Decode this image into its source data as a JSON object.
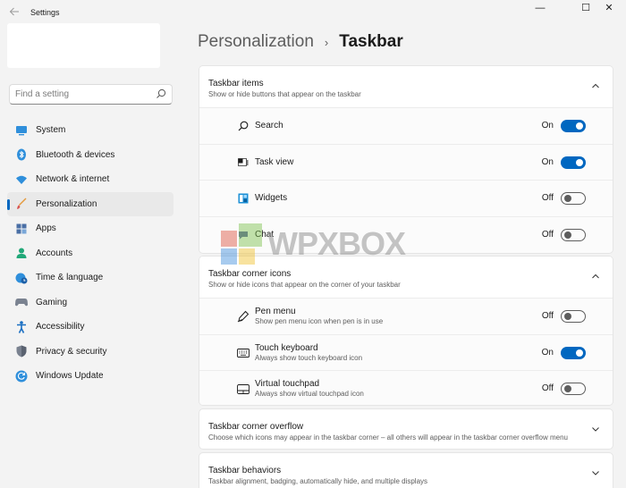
{
  "app": {
    "title": "Settings",
    "window_controls": {
      "minimize": "—",
      "maximize": "☐",
      "close": "✕"
    }
  },
  "search": {
    "placeholder": "Find a setting",
    "value": ""
  },
  "sidebar": {
    "items": [
      {
        "label": "System",
        "icon": "system-icon",
        "active": false
      },
      {
        "label": "Bluetooth & devices",
        "icon": "bluetooth-icon",
        "active": false
      },
      {
        "label": "Network & internet",
        "icon": "wifi-icon",
        "active": false
      },
      {
        "label": "Personalization",
        "icon": "brush-icon",
        "active": true
      },
      {
        "label": "Apps",
        "icon": "apps-icon",
        "active": false
      },
      {
        "label": "Accounts",
        "icon": "person-icon",
        "active": false
      },
      {
        "label": "Time & language",
        "icon": "globe-clock-icon",
        "active": false
      },
      {
        "label": "Gaming",
        "icon": "gamepad-icon",
        "active": false
      },
      {
        "label": "Accessibility",
        "icon": "accessibility-icon",
        "active": false
      },
      {
        "label": "Privacy & security",
        "icon": "shield-icon",
        "active": false
      },
      {
        "label": "Windows Update",
        "icon": "update-icon",
        "active": false
      }
    ]
  },
  "breadcrumb": {
    "parent": "Personalization",
    "separator": "›",
    "current": "Taskbar"
  },
  "taskbar_items": {
    "title": "Taskbar items",
    "description": "Show or hide buttons that appear on the taskbar",
    "rows": [
      {
        "label": "Search",
        "state": "On",
        "icon": "search-icon"
      },
      {
        "label": "Task view",
        "state": "On",
        "icon": "task-view-icon"
      },
      {
        "label": "Widgets",
        "state": "Off",
        "icon": "widgets-icon"
      },
      {
        "label": "Chat",
        "state": "Off",
        "icon": "chat-icon"
      }
    ]
  },
  "corner_icons": {
    "title": "Taskbar corner icons",
    "description": "Show or hide icons that appear on the corner of your taskbar",
    "rows": [
      {
        "label": "Pen menu",
        "sub": "Show pen menu icon when pen is in use",
        "state": "Off",
        "icon": "pen-icon"
      },
      {
        "label": "Touch keyboard",
        "sub": "Always show touch keyboard icon",
        "state": "On",
        "icon": "keyboard-icon"
      },
      {
        "label": "Virtual touchpad",
        "sub": "Always show virtual touchpad icon",
        "state": "Off",
        "icon": "touchpad-icon"
      }
    ]
  },
  "corner_overflow": {
    "title": "Taskbar corner overflow",
    "description": "Choose which icons may appear in the taskbar corner – all others will appear in the taskbar corner overflow menu"
  },
  "behaviors": {
    "title": "Taskbar behaviors",
    "description": "Taskbar alignment, badging, automatically hide, and multiple displays"
  },
  "watermark": {
    "text": "WPXBOX"
  },
  "colors": {
    "accent": "#0067c0",
    "background": "#f3f3f3",
    "card": "#ffffff"
  }
}
